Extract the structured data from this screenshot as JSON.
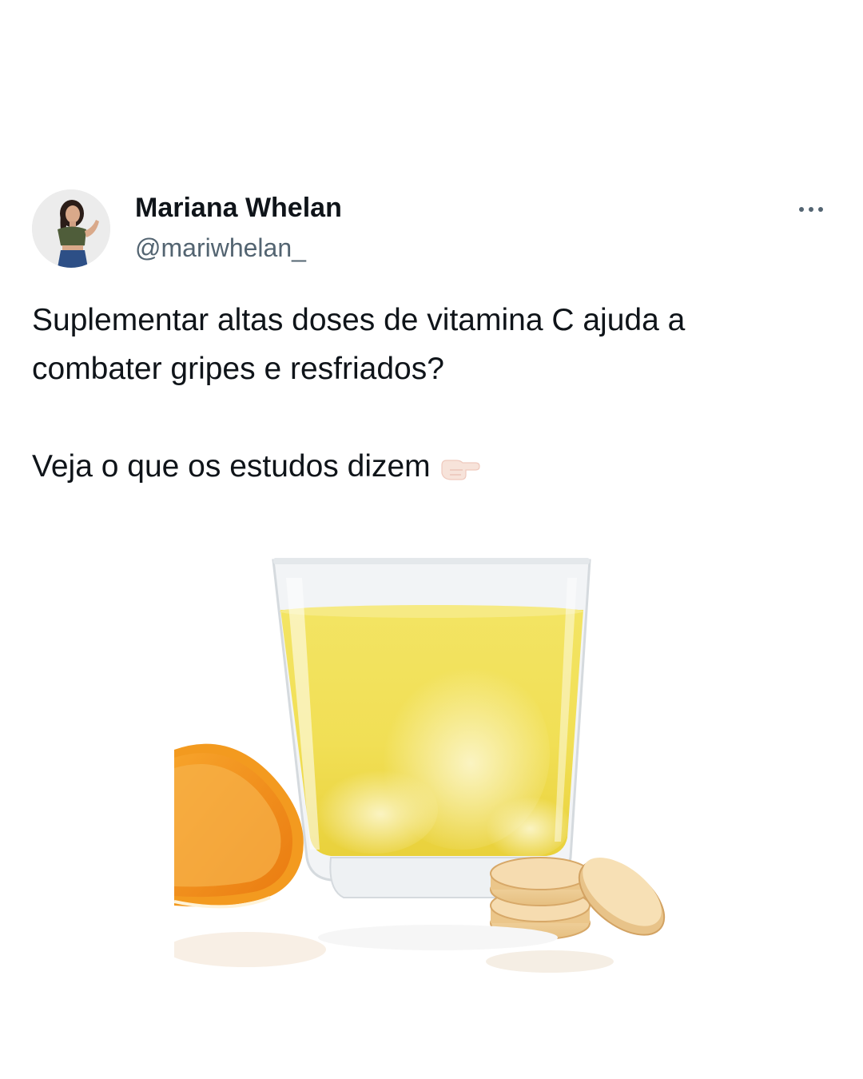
{
  "author": {
    "name": "Mariana Whelan",
    "handle": "@mariwhelan_"
  },
  "tweet": {
    "line_1": "Suplementar altas doses de vitamina C ajuda a",
    "line_2": "combater gripes e resfriados?",
    "line_3": "Veja o que os estudos dizem"
  },
  "icons": {
    "more": "more-dots-icon",
    "pointing": "backhand-index-pointing-right-icon"
  }
}
